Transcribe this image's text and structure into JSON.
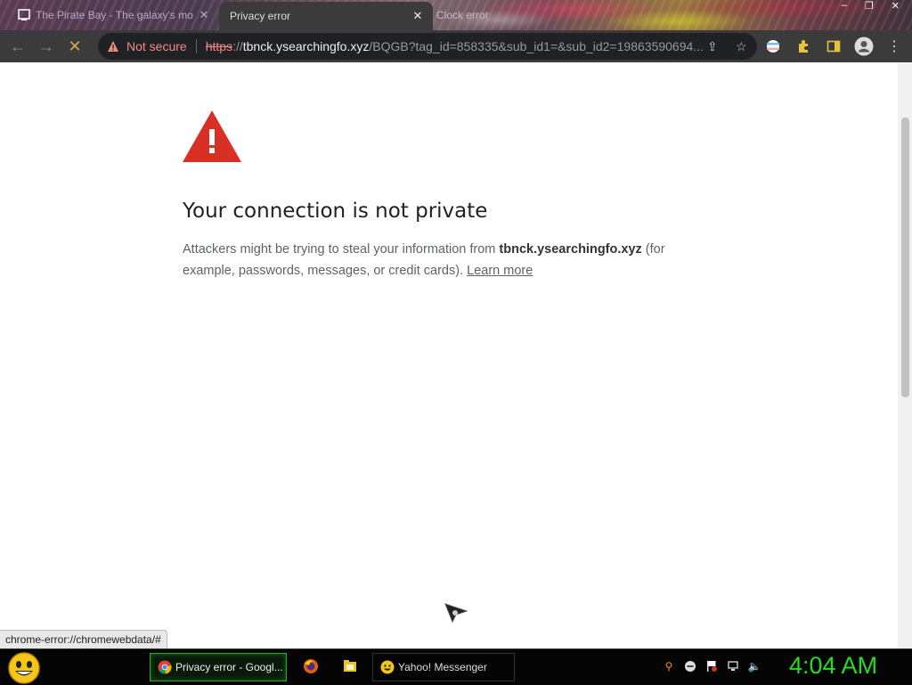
{
  "tabs": [
    {
      "title": "The Pirate Bay - The galaxy's mo",
      "active": false
    },
    {
      "title": "Privacy error",
      "active": true
    },
    {
      "title": "Clock error",
      "active": false
    }
  ],
  "window_controls": {
    "minimize": "–",
    "restore": "❐",
    "close": "✕"
  },
  "toolbar": {
    "security_label": "Not secure",
    "url_scheme": "https",
    "url_sep": "://",
    "url_host": "tbnck.ysearchingfo.xyz",
    "url_rest": "/BQGB?tag_id=858335&sub_id1=&sub_id2=19863590694..."
  },
  "page": {
    "heading": "Your connection is not private",
    "desc_before": "Attackers might be trying to steal your information from ",
    "desc_host": "tbnck.ysearchingfo.xyz",
    "desc_after": " (for example, passwords, messages, or credit cards). ",
    "learn_more": "Learn more"
  },
  "status_url": "chrome-error://chromewebdata/#",
  "taskbar": {
    "tasks": [
      {
        "label": "Privacy error - Googl...",
        "icon": "chrome-icon"
      },
      {
        "label": "Yahoo! Messenger",
        "icon": "yahoo-smiley-icon"
      }
    ],
    "clock": "4:04 AM"
  },
  "colors": {
    "warning_red": "#d93025",
    "clock_green": "#22dd22",
    "not_secure_red": "#f28b82"
  }
}
